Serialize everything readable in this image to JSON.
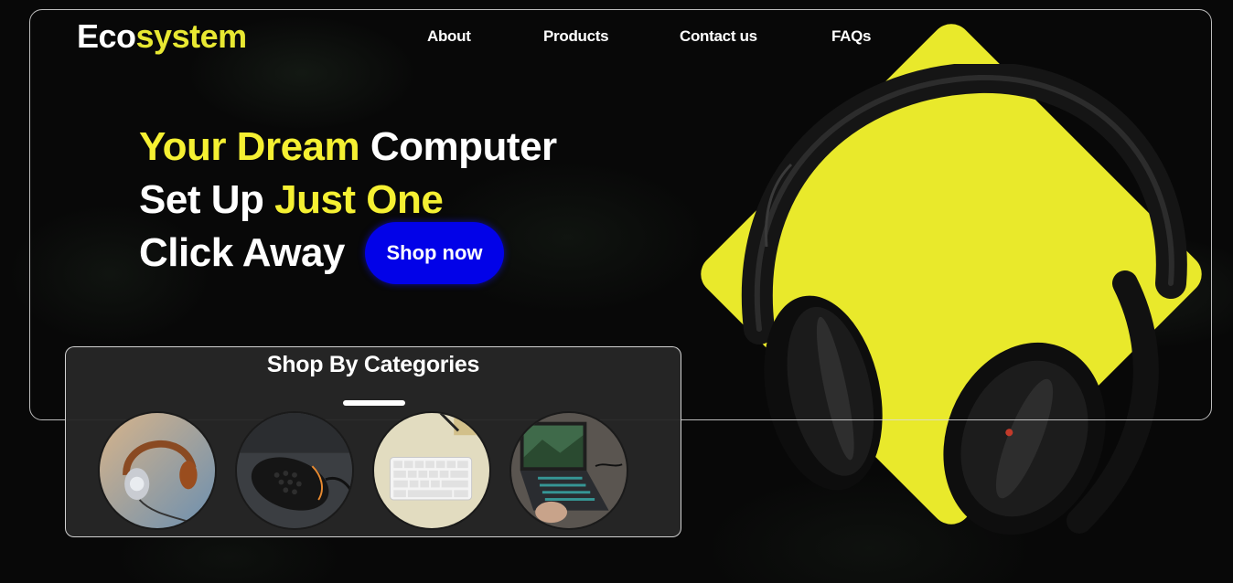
{
  "brand": {
    "part1": "Eco",
    "part2": "system"
  },
  "nav": {
    "items": [
      "About",
      "Products",
      "Contact us",
      "FAQs"
    ]
  },
  "hero": {
    "line1_accent": "Your Dream",
    "line1_rest": "Computer",
    "line2_start": "Set Up",
    "line2_accent": "Just One",
    "line3": "Click Away",
    "cta_label": "Shop now"
  },
  "categories": {
    "title": "Shop By Categories",
    "items": [
      {
        "icon": "headphones-category-icon"
      },
      {
        "icon": "mouse-category-icon"
      },
      {
        "icon": "keyboard-category-icon"
      },
      {
        "icon": "laptop-category-icon"
      }
    ]
  },
  "colors": {
    "accent_yellow": "#f5f032",
    "button_blue": "#0202e8",
    "background": "#070707"
  }
}
